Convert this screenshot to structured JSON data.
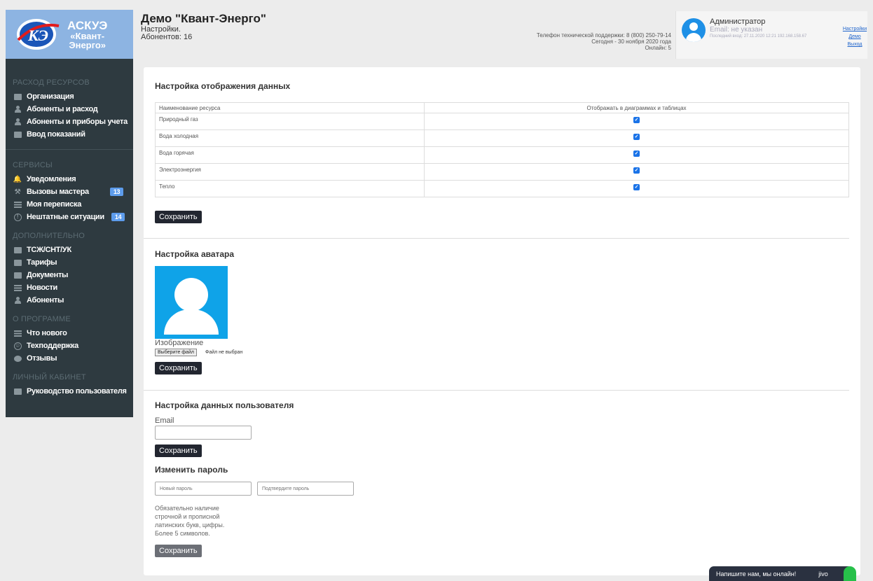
{
  "logo": {
    "line1": "АСКУЭ",
    "line2": "«Квант-",
    "line3": "Энерго»"
  },
  "header": {
    "title": "Демо \"Квант-Энерго\"",
    "breadcrumb": "Настройки.",
    "subscribers": "Абонентов: 16",
    "support_phone": "Телефон технической поддержки: 8 (800) 250-79-14",
    "today": "Сегодня - 30 ноября 2020 года",
    "online": "Онлайн: 5"
  },
  "user": {
    "name": "Администратор",
    "email": "Email: не указан",
    "last_login": "Последний вход: 27.11.2020 12:21 192.168.158.67",
    "links": [
      "Настройки",
      "Демо",
      "Выход"
    ]
  },
  "sidebar": {
    "sections": [
      {
        "title": "РАСХОД РЕСУРСОВ",
        "items": [
          {
            "label": "Организация",
            "icon": "briefcase-icon"
          },
          {
            "label": "Абоненты и расход",
            "icon": "user-icon"
          },
          {
            "label": "Абоненты и приборы учета",
            "icon": "user-icon"
          },
          {
            "label": "Ввод показаний",
            "icon": "chart-icon"
          }
        ]
      },
      {
        "title": "СЕРВИСЫ",
        "items": [
          {
            "label": "Уведомления",
            "icon": "bell-icon"
          },
          {
            "label": "Вызовы мастера",
            "icon": "wrench-icon",
            "badge": "13"
          },
          {
            "label": "Моя переписка",
            "icon": "list-icon"
          },
          {
            "label": "Нештатные ситуации",
            "icon": "warning-icon",
            "badge": "14"
          }
        ]
      },
      {
        "title": "ДОПОЛНИТЕЛЬНО",
        "items": [
          {
            "label": "ТСЖ/СНТ/УК",
            "icon": "briefcase-icon"
          },
          {
            "label": "Тарифы",
            "icon": "chart-icon"
          },
          {
            "label": "Документы",
            "icon": "folder-icon"
          },
          {
            "label": "Новости",
            "icon": "list-icon"
          },
          {
            "label": "Абоненты",
            "icon": "user-icon"
          }
        ]
      },
      {
        "title": "О ПРОГРАММЕ",
        "items": [
          {
            "label": "Что нового",
            "icon": "list-icon"
          },
          {
            "label": "Техподдержка",
            "icon": "smile-icon"
          },
          {
            "label": "Отзывы",
            "icon": "comment-icon"
          }
        ]
      },
      {
        "title": "ЛИЧНЫЙ КАБИНЕТ",
        "items": [
          {
            "label": "Руководство пользователя",
            "icon": "briefcase-icon"
          }
        ]
      }
    ]
  },
  "display_settings": {
    "title": "Настройка отображения данных",
    "col_resource": "Наименование ресурса",
    "col_display": "Отображать в диаграммах и таблицах",
    "rows": [
      {
        "name": "Природный газ",
        "checked": true
      },
      {
        "name": "Вода холодная",
        "checked": true
      },
      {
        "name": "Вода горячая",
        "checked": true
      },
      {
        "name": "Электроэнергия",
        "checked": true
      },
      {
        "name": "Тепло",
        "checked": true
      }
    ],
    "save": "Сохранить"
  },
  "avatar_settings": {
    "title": "Настройка аватара",
    "image_label": "Изображение",
    "choose_file": "Выберите файл",
    "no_file": "Файл не выбран",
    "save": "Сохранить"
  },
  "user_settings": {
    "title": "Настройка данных пользователя",
    "email_label": "Email",
    "email_value": "",
    "save": "Сохранить"
  },
  "password": {
    "title": "Изменить пароль",
    "new_placeholder": "Новый пароль",
    "confirm_placeholder": "Подтвердите пароль",
    "hint": "Обязательно наличие строчной и прописной латинских букв, цифры. Более 5 символов.",
    "save": "Сохранить"
  },
  "chat": {
    "text": "Напишите нам, мы онлайн!",
    "brand": "jivo"
  },
  "colors": {
    "sidebar": "#2e3a40",
    "logo_bg": "#8db4e2",
    "accent": "#1a73e8",
    "badge": "#5d9cec"
  }
}
